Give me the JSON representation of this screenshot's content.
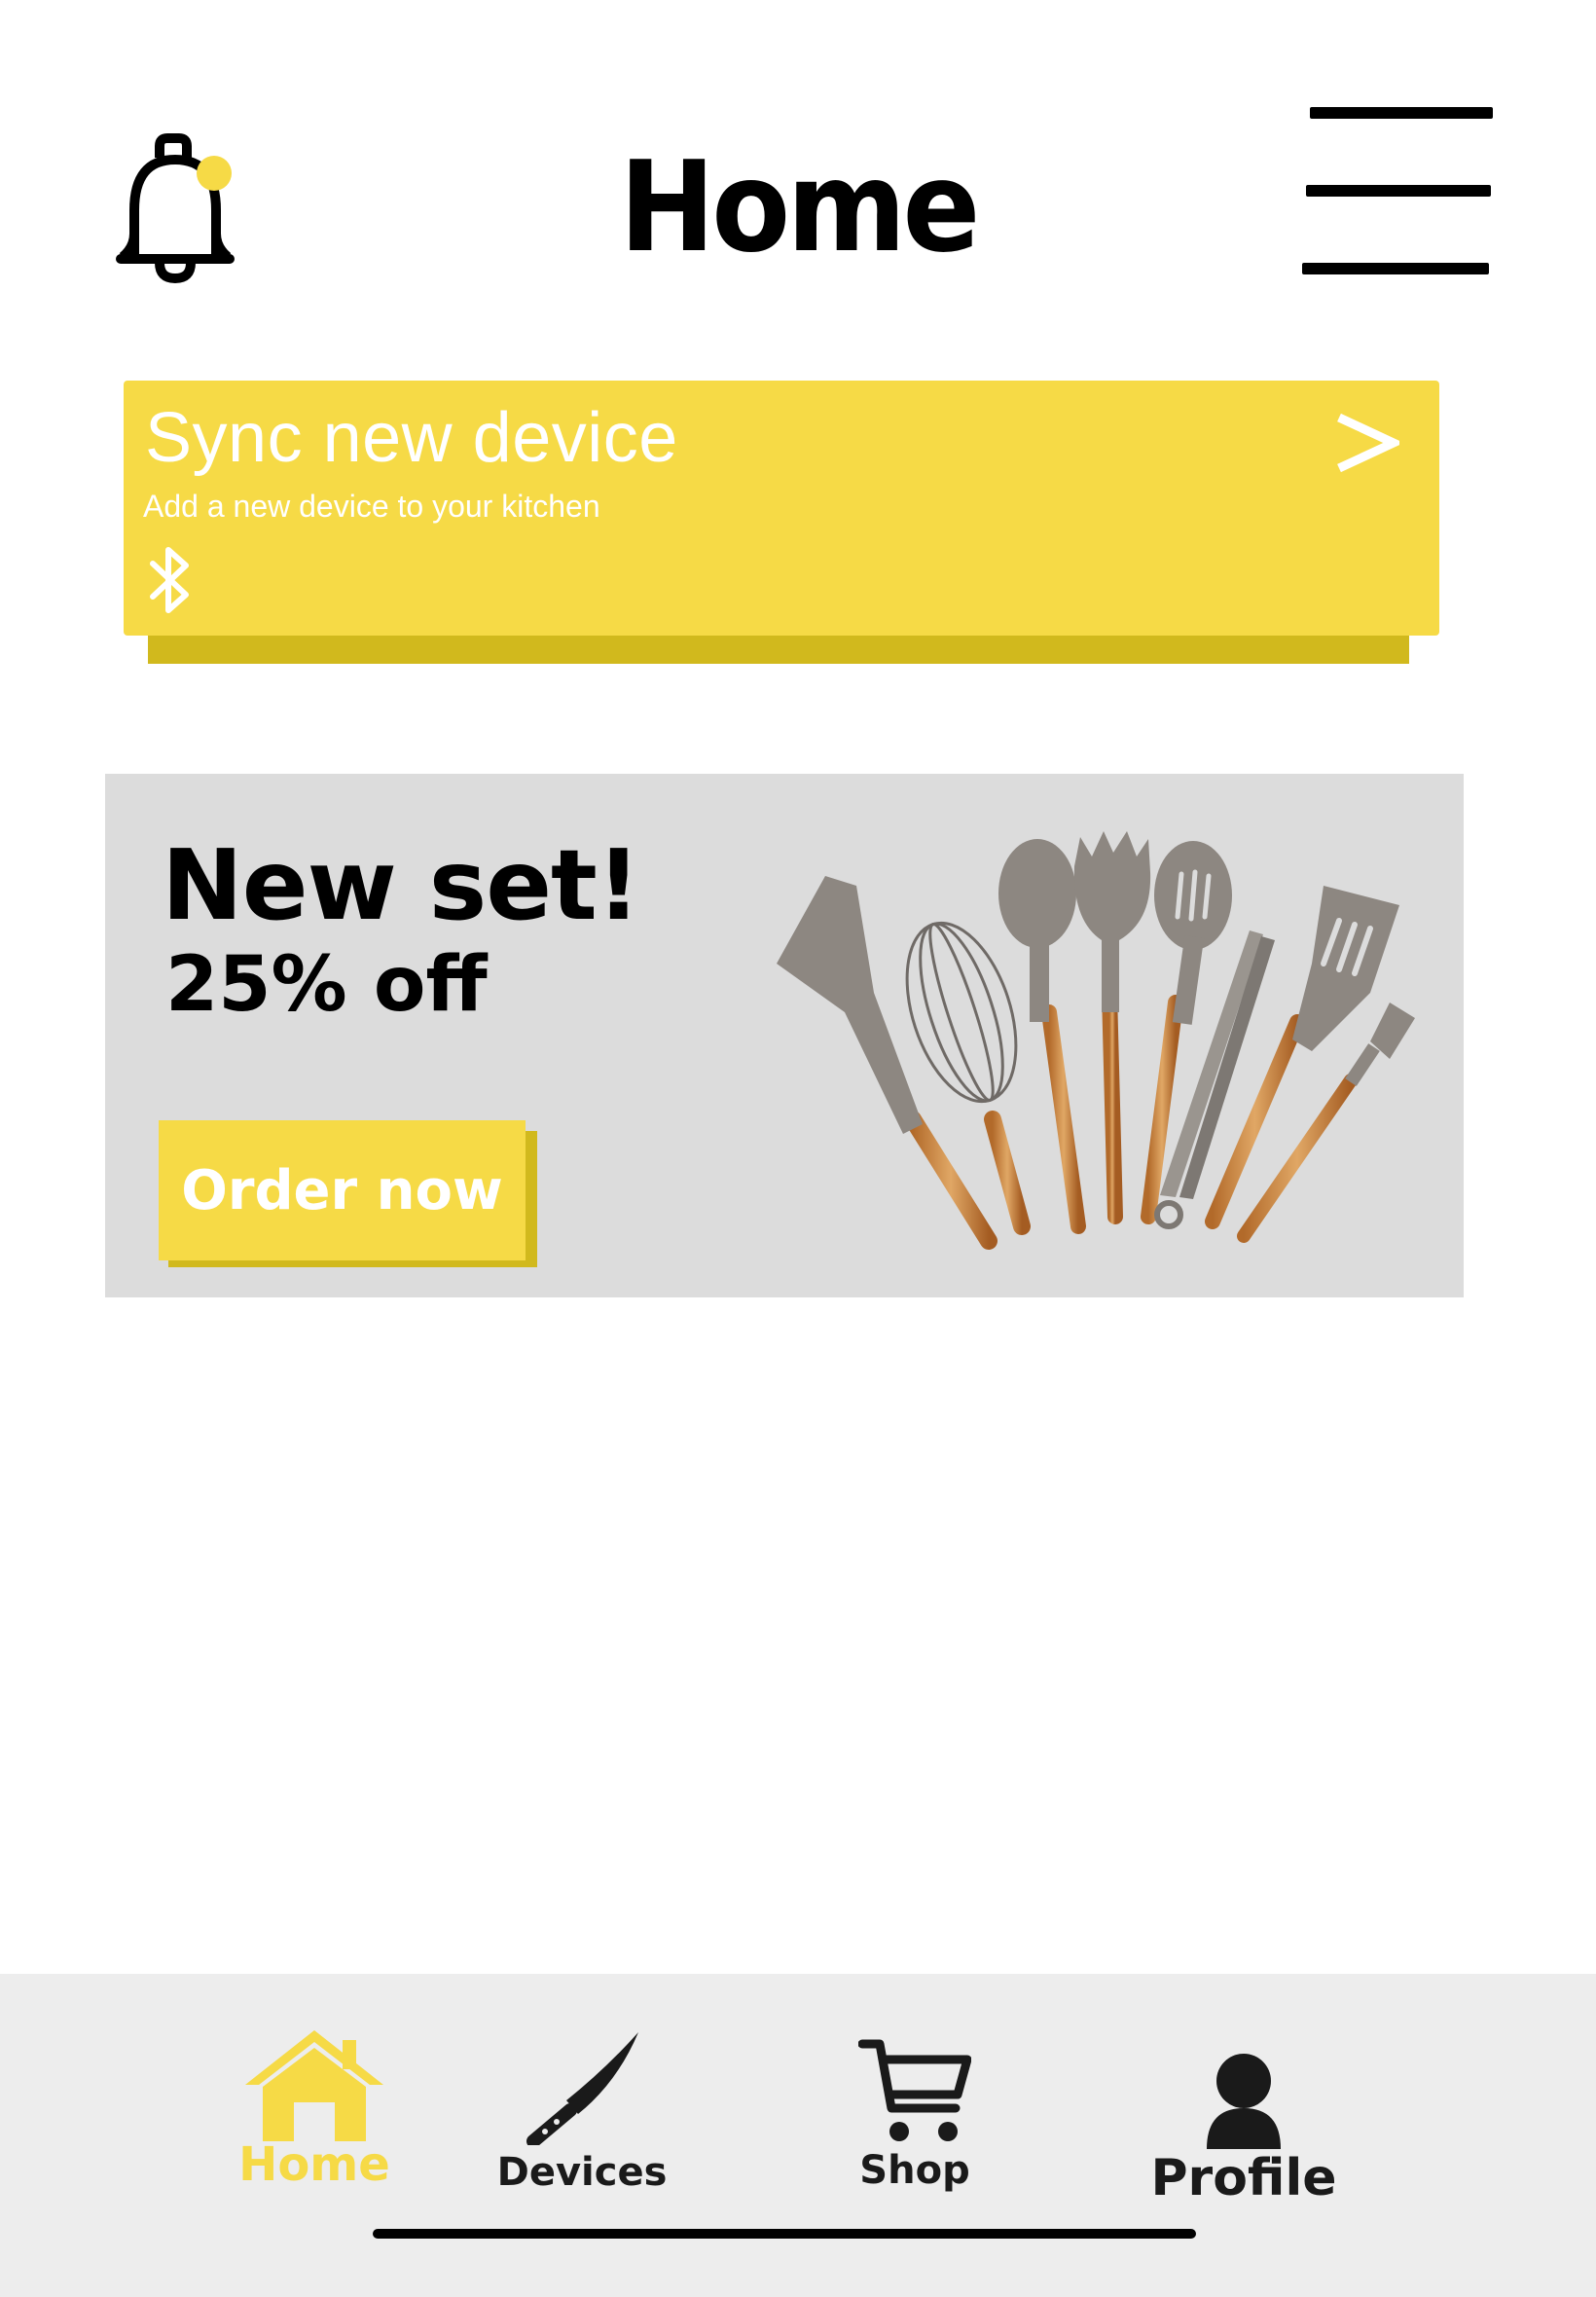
{
  "header": {
    "title": "Home",
    "notification_icon": "bell-icon",
    "menu_icon": "hamburger-menu-icon"
  },
  "sync_card": {
    "title": "Sync new device",
    "subtitle": "Add a new device to your kitchen",
    "arrow": ">",
    "icon": "bluetooth-icon"
  },
  "promo": {
    "title": "New set!",
    "subtitle": "25% off",
    "button_label": "Order now",
    "image": "kitchen-utensil-set"
  },
  "bottom_nav": {
    "items": [
      {
        "label": "Home",
        "icon": "home-icon",
        "active": true
      },
      {
        "label": "Devices",
        "icon": "knife-icon",
        "active": false
      },
      {
        "label": "Shop",
        "icon": "cart-icon",
        "active": false
      },
      {
        "label": "Profile",
        "icon": "person-icon",
        "active": false
      }
    ]
  },
  "colors": {
    "accent": "#f6da46",
    "accent_shadow": "#d1b91d",
    "promo_bg": "#dcdcdc",
    "nav_bg": "#ededed"
  }
}
